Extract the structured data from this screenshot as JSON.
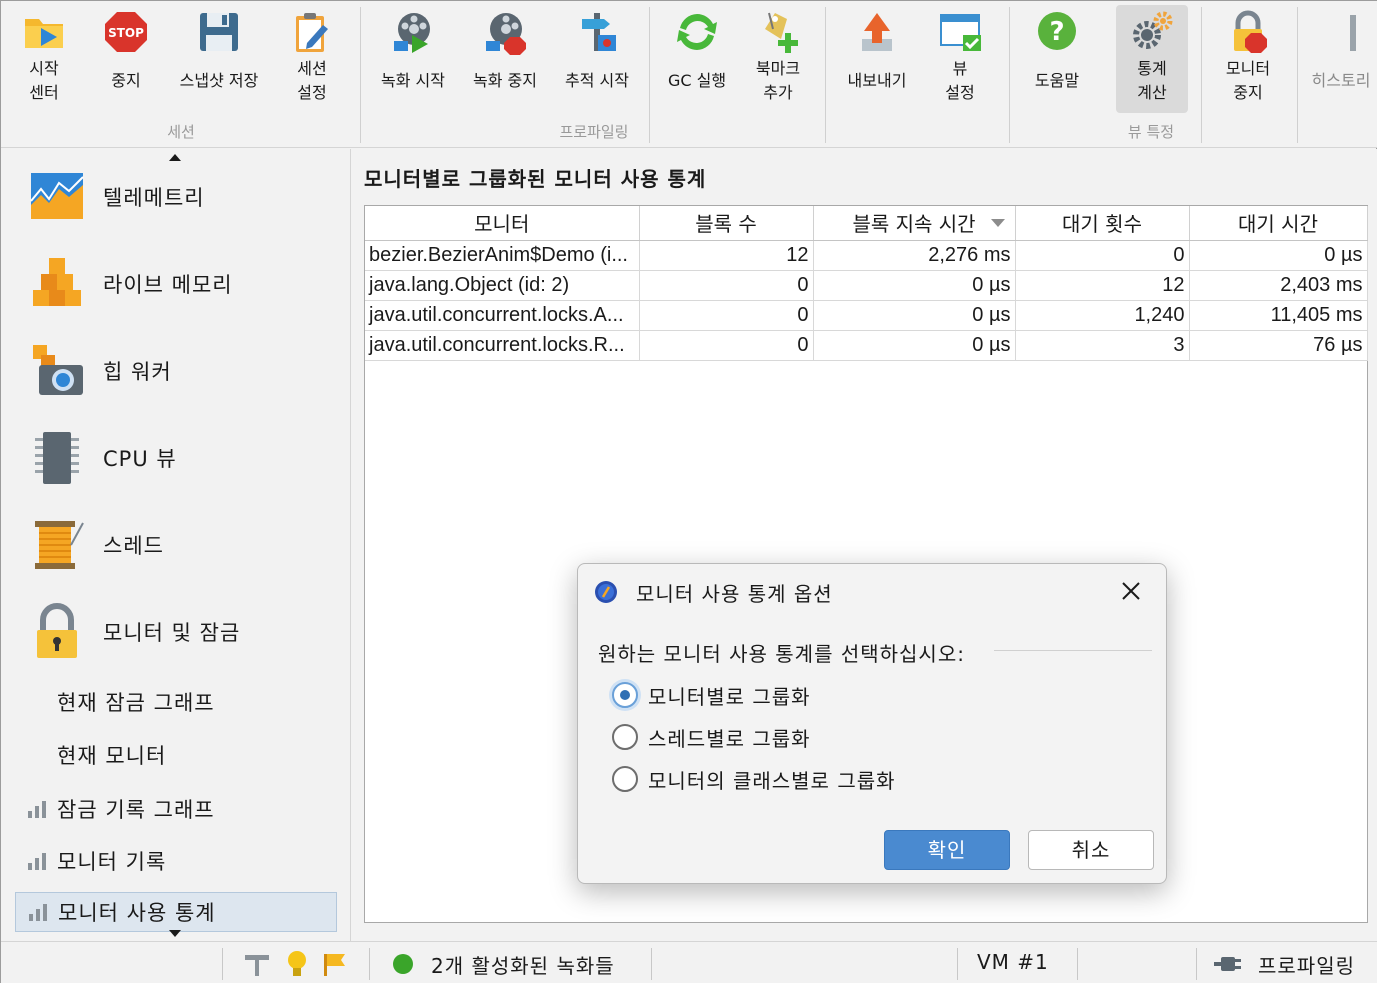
{
  "toolbar": {
    "buttons": [
      {
        "label": "시작\n센터"
      },
      {
        "label": "중지"
      },
      {
        "label": "스냅샷 저장"
      },
      {
        "label": "세션\n설정"
      },
      {
        "label": "녹화 시작"
      },
      {
        "label": "녹화 중지"
      },
      {
        "label": "추적 시작"
      },
      {
        "label": "GC 실행"
      },
      {
        "label": "북마크\n추가"
      },
      {
        "label": "내보내기"
      },
      {
        "label": "뷰\n설정"
      },
      {
        "label": "도움말"
      },
      {
        "label": "통계\n계산"
      },
      {
        "label": "모니터\n중지"
      },
      {
        "label": "히스토리"
      }
    ],
    "groups": {
      "session": "세션",
      "profiling": "프로파일링",
      "view_specific": "뷰 특정"
    },
    "stop_text": "STOP"
  },
  "sidebar": {
    "big_items": [
      {
        "label": "텔레메트리"
      },
      {
        "label": "라이브 메모리"
      },
      {
        "label": "힙 워커"
      },
      {
        "label": "CPU 뷰"
      },
      {
        "label": "스레드"
      },
      {
        "label": "모니터 및 잠금"
      }
    ],
    "sub_items": [
      {
        "label": "현재 잠금 그래프"
      },
      {
        "label": "현재 모니터"
      }
    ],
    "history_items": [
      {
        "label": "잠금 기록 그래프"
      },
      {
        "label": "모니터 기록"
      },
      {
        "label": "모니터 사용 통계",
        "selected": true
      }
    ]
  },
  "content": {
    "title": "모니터별로 그룹화된 모니터 사용 통계",
    "columns": [
      "모니터",
      "블록 수",
      "블록 지속 시간",
      "대기 횟수",
      "대기 시간"
    ],
    "sorted_column": "블록 지속 시간",
    "rows": [
      {
        "monitor": "bezier.BezierAnim$Demo (i...",
        "block_count": "12",
        "block_duration": "2,276 ms",
        "wait_count": "0",
        "wait_time": "0 µs"
      },
      {
        "monitor": "java.lang.Object (id: 2)",
        "block_count": "0",
        "block_duration": "0 µs",
        "wait_count": "12",
        "wait_time": "2,403 ms"
      },
      {
        "monitor": "java.util.concurrent.locks.A...",
        "block_count": "0",
        "block_duration": "0 µs",
        "wait_count": "1,240",
        "wait_time": "11,405 ms"
      },
      {
        "monitor": "java.util.concurrent.locks.R...",
        "block_count": "0",
        "block_duration": "0 µs",
        "wait_count": "3",
        "wait_time": "76 µs"
      }
    ]
  },
  "statusbar": {
    "recordings": "2개 활성화된 녹화들",
    "vm": "VM #1",
    "mode": "프로파일링"
  },
  "dialog": {
    "title": "모니터 사용 통계 옵션",
    "prompt": "원하는 모니터 사용 통계를 선택하십시오:",
    "options": [
      {
        "label": "모니터별로 그룹화",
        "selected": true
      },
      {
        "label": "스레드별로 그룹화",
        "selected": false
      },
      {
        "label": "모니터의 클래스별로 그룹화",
        "selected": false
      }
    ],
    "ok": "확인",
    "cancel": "취소"
  },
  "colors": {
    "accent": "#4a8ad0",
    "selection": "#dde6ef",
    "stop_red": "#d9342b",
    "status_green": "#3aa52a"
  }
}
